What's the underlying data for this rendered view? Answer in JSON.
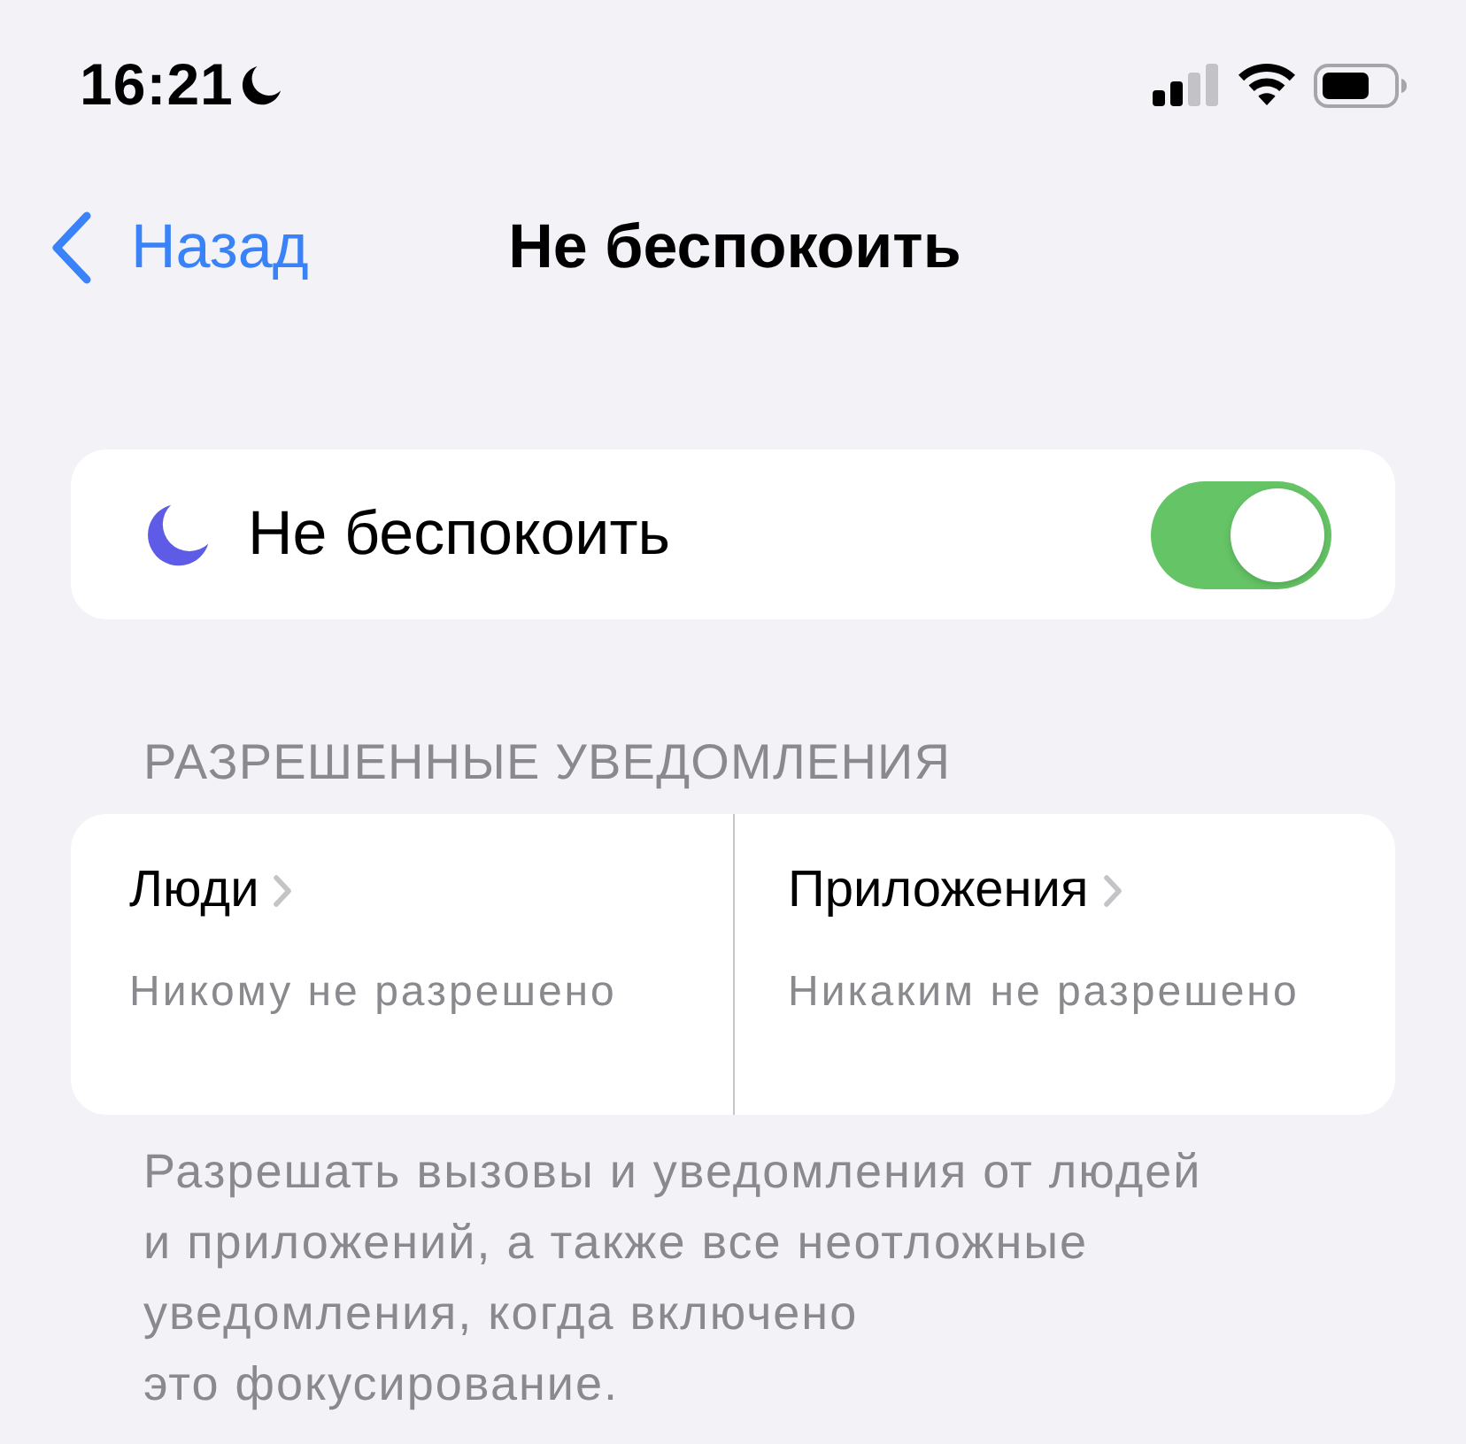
{
  "status_bar": {
    "time": "16:21"
  },
  "nav": {
    "back": "Назад",
    "title": "Не беспокоить"
  },
  "focus_card": {
    "label": "Не беспокоить",
    "on": true
  },
  "allowed": {
    "header": "РАЗРЕШЕННЫЕ УВЕДОМЛЕНИЯ",
    "items": [
      {
        "title": "Люди",
        "subtitle": "Никому не разрешено"
      },
      {
        "title": "Приложения",
        "subtitle": "Никаким не разрешено"
      }
    ]
  },
  "footer": "Разрешать вызовы и уведомления от людей\nи приложений, а также все неотложные\nуведомления, когда включено\nэто фокусирование."
}
